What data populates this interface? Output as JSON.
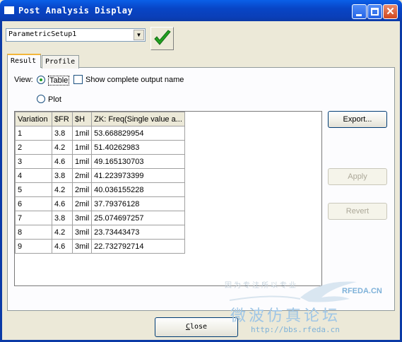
{
  "window": {
    "title": "Post Analysis Display"
  },
  "setup": {
    "selected": "ParametricSetup1"
  },
  "tabs": [
    {
      "label": "Result"
    },
    {
      "label": "Profile"
    }
  ],
  "view": {
    "label": "View:",
    "options": [
      {
        "label": "Table",
        "selected": true
      },
      {
        "label": "Plot",
        "selected": false
      }
    ],
    "show_complete_label": "Show complete output name",
    "show_complete_checked": false
  },
  "table": {
    "columns": [
      "Variation",
      "$FR",
      "$H",
      "ZK: Freq(Single value a..."
    ],
    "rows": [
      [
        "1",
        "3.8",
        "1mil",
        "53.668829954"
      ],
      [
        "2",
        "4.2",
        "1mil",
        "51.40262983"
      ],
      [
        "3",
        "4.6",
        "1mil",
        "49.165130703"
      ],
      [
        "4",
        "3.8",
        "2mil",
        "41.223973399"
      ],
      [
        "5",
        "4.2",
        "2mil",
        "40.036155228"
      ],
      [
        "6",
        "4.6",
        "2mil",
        "37.79376128"
      ],
      [
        "7",
        "3.8",
        "3mil",
        "25.074697257"
      ],
      [
        "8",
        "4.2",
        "3mil",
        "23.73443473"
      ],
      [
        "9",
        "4.6",
        "3mil",
        "22.732792714"
      ]
    ]
  },
  "buttons": {
    "export": "Export...",
    "apply": "Apply",
    "revert": "Revert",
    "close_mnemonic": "C",
    "close_rest": "lose"
  },
  "watermark": {
    "small": "因为专注所以专业",
    "brand": "RFEDA.CN",
    "chinese": "微波仿真论坛",
    "url": "http://bbs.rfeda.cn"
  },
  "colors": {
    "title_bar": "#0a4fd4",
    "accent_check": "#21a121",
    "tab_highlight": "#f3b63a"
  }
}
